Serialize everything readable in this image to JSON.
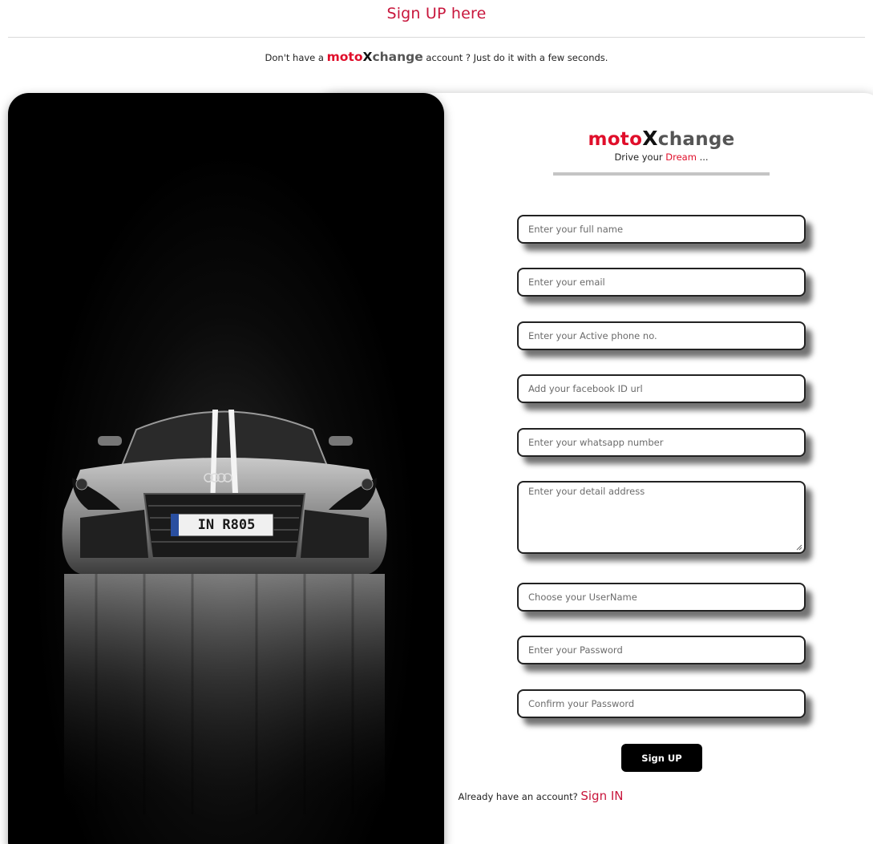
{
  "page": {
    "heading": "Sign UP here",
    "tagline_prefix": "Don't have a",
    "tagline_suffix": "account ? Just do it with a few seconds."
  },
  "brand": {
    "part1": "moto",
    "part2": "X",
    "part3": "change",
    "slogan_prefix": "Drive your",
    "slogan_highlight": "Dream",
    "slogan_suffix": "...",
    "colors": {
      "moto": "#e00e2a",
      "x": "#111111",
      "change": "#555555",
      "accent": "#c8163c"
    }
  },
  "hero": {
    "plate_text": "IN R805",
    "icon": "car-photo"
  },
  "form": {
    "full_name_placeholder": "Enter your full name",
    "email_placeholder": "Enter your email",
    "phone_placeholder": "Enter your Active phone no.",
    "facebook_placeholder": "Add your facebook ID url",
    "whatsapp_placeholder": "Enter your whatsapp number",
    "address_placeholder": "Enter your detail address",
    "username_placeholder": "Choose your UserName",
    "password_placeholder": "Enter your Password",
    "confirm_password_placeholder": "Confirm your Password",
    "submit_label": "Sign UP"
  },
  "signin": {
    "prompt": "Already have an account?",
    "link_label": "Sign IN"
  }
}
